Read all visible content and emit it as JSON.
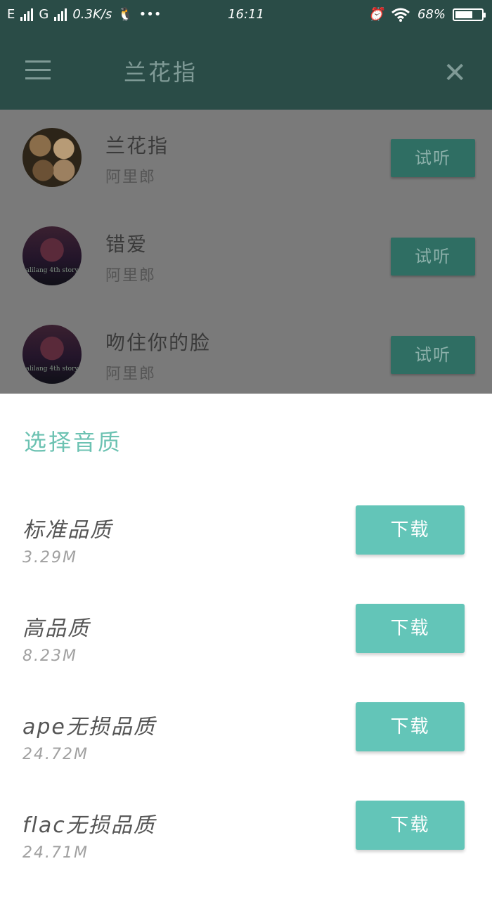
{
  "status_bar": {
    "carrier1": "E",
    "carrier2": "G",
    "speed": "0.3K/s",
    "dots": "•••",
    "time": "16:11",
    "battery": "68%",
    "battery_level": 0.68
  },
  "appbar": {
    "title": "兰花指"
  },
  "songs": [
    {
      "title": "兰花指",
      "artist": "阿里郎",
      "button": "试听",
      "cover_text": ""
    },
    {
      "title": "错爱",
      "artist": "阿里郎",
      "button": "试听",
      "cover_text": "alilang 4th story"
    },
    {
      "title": "吻住你的脸",
      "artist": "阿里郎",
      "button": "试听",
      "cover_text": "alilang 4th story"
    }
  ],
  "sheet": {
    "title": "选择音质",
    "options": [
      {
        "name": "标准品质",
        "size": "3.29M",
        "button": "下载"
      },
      {
        "name": "高品质",
        "size": "8.23M",
        "button": "下载"
      },
      {
        "name": "ape无损品质",
        "size": "24.72M",
        "button": "下载"
      },
      {
        "name": "flac无损品质",
        "size": "24.71M",
        "button": "下载"
      }
    ]
  },
  "colors": {
    "appbar": "#2a4c47",
    "accent": "#63c5b8",
    "sheet_title": "#6cc2b2"
  }
}
